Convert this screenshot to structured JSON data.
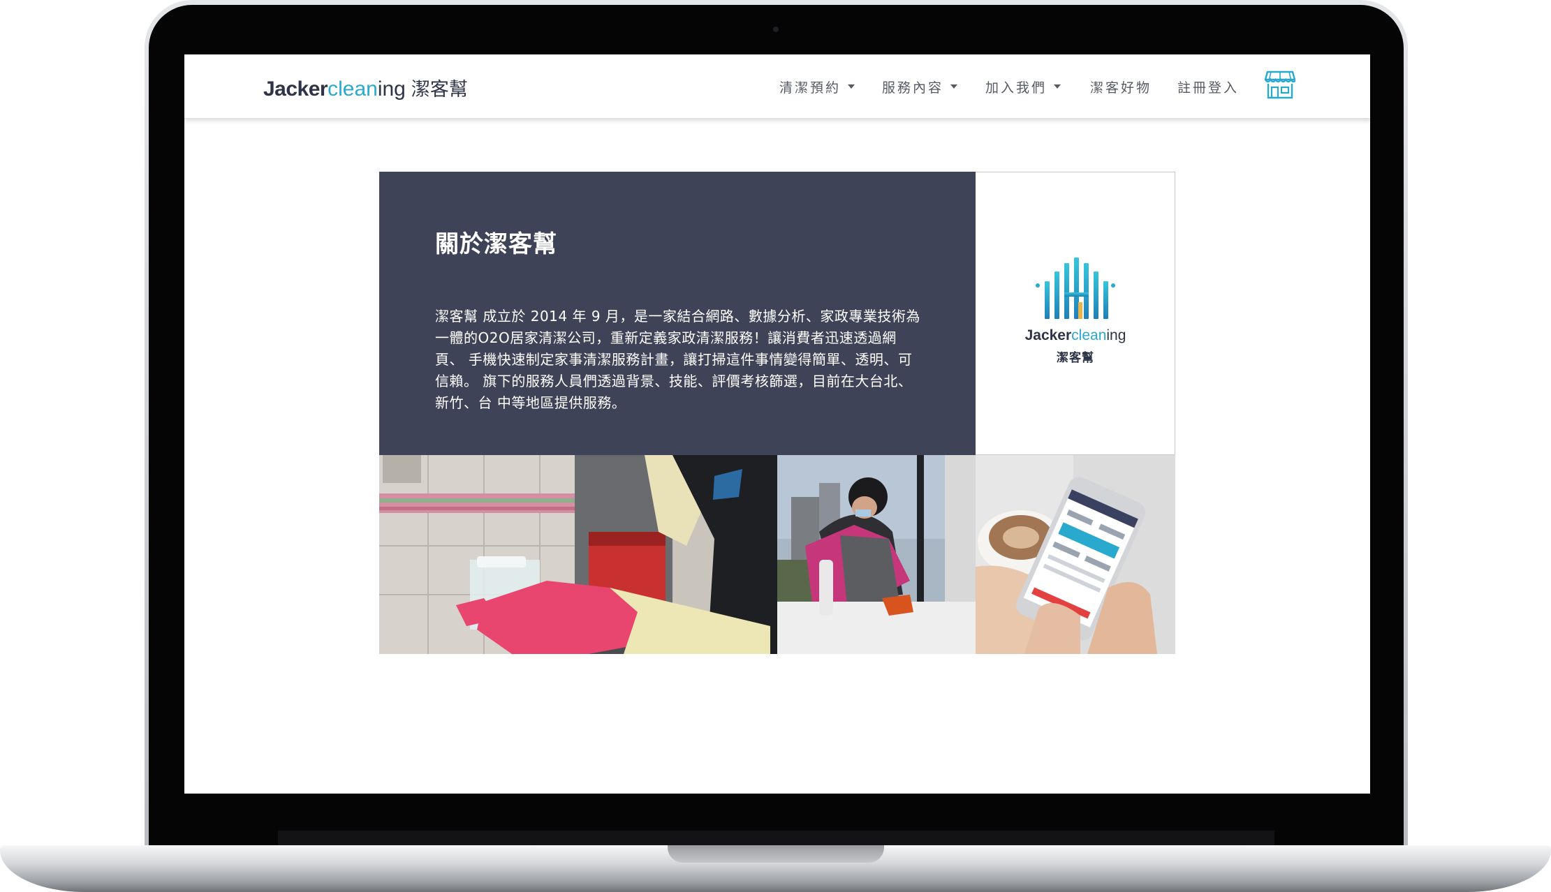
{
  "brand": {
    "part1": "Jacker",
    "part2": "clean",
    "part3": "ing",
    "chinese": "潔客幫"
  },
  "nav": {
    "items": [
      {
        "label": "清潔預約",
        "dropdown": true
      },
      {
        "label": "服務內容",
        "dropdown": true
      },
      {
        "label": "加入我們",
        "dropdown": true
      },
      {
        "label": "潔客好物",
        "dropdown": false
      },
      {
        "label": "註冊登入",
        "dropdown": false
      }
    ],
    "shop_icon": "storefront-icon"
  },
  "about": {
    "title": "關於潔客幫",
    "body": "潔客幫 成立於 2014 年 9 月，是一家結合網路、數據分析、家政專業技術為一體的O2O居家清潔公司，重新定義家政清潔服務！讓消費者迅速透過網頁、 手機快速制定家事清潔服務計畫，讓打掃這件事情變得簡單、透明、可信賴。 旗下的服務人員們透過背景、技能、評價考核篩選，目前在大台北、新竹、台 中等地區提供服務。"
  },
  "logo_panel": {
    "part1": "Jacker",
    "part2": "clean",
    "part3": "ing",
    "chinese": "潔客幫"
  },
  "colors": {
    "brand_dark": "#2e3447",
    "brand_accent": "#2aa9cf",
    "panel_bg": "#3f4358",
    "nav_text": "#555a63"
  }
}
